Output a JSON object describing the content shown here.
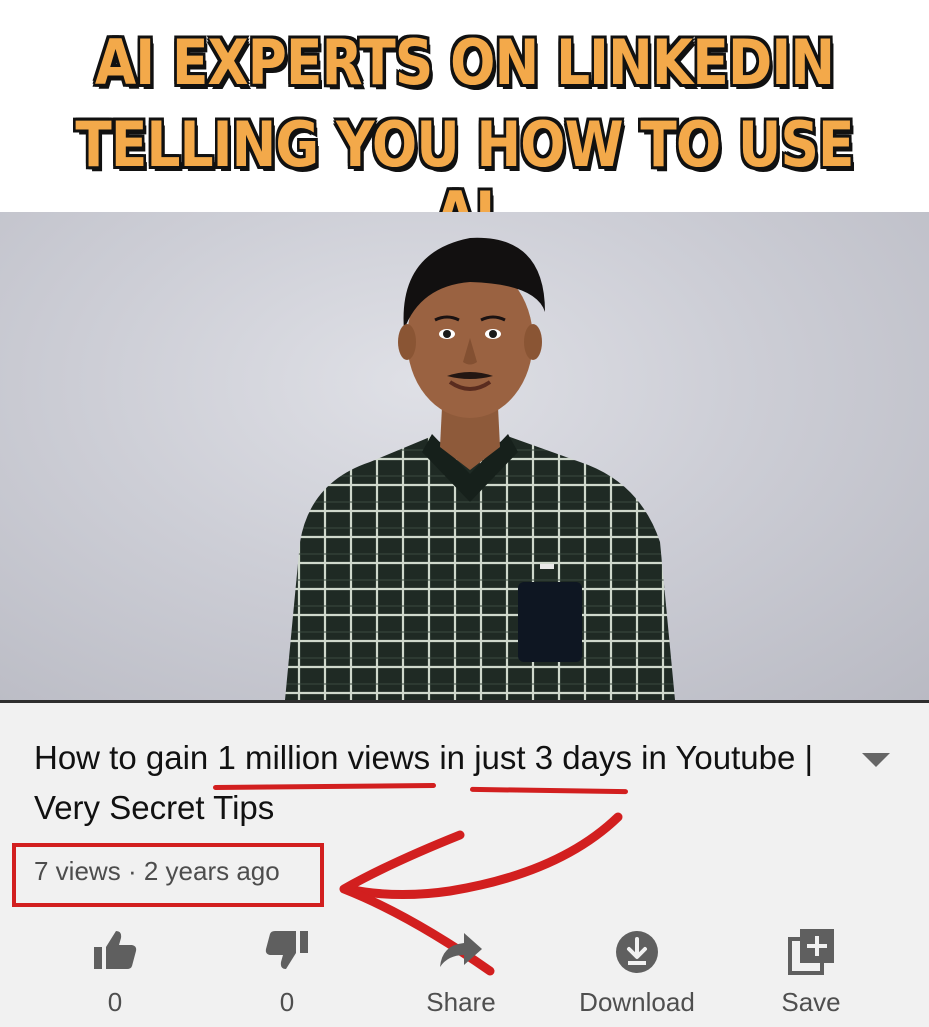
{
  "meme": {
    "line1": "AI EXPERTS ON LINKEDIN",
    "line2": "TELLING YOU HOW TO USE AI"
  },
  "video": {
    "title_parts": [
      "How to gain ",
      "1 million views",
      " in ",
      "just 3 days",
      " in Youtube | Very Secret Tips"
    ],
    "views": "7 views",
    "separator": "·",
    "age": "2 years ago"
  },
  "actions": {
    "like_count": "0",
    "dislike_count": "0",
    "share_label": "Share",
    "download_label": "Download",
    "save_label": "Save"
  },
  "icons": {
    "like": "thumbs-up-icon",
    "dislike": "thumbs-down-icon",
    "share": "share-arrow-icon",
    "download": "download-circle-icon",
    "save": "playlist-add-icon",
    "expand": "chevron-down-icon"
  },
  "colors": {
    "caption_fill": "#f3a94a",
    "caption_outline": "#111111",
    "annotation_red": "#d21f1f",
    "panel_bg": "#f1f1f1"
  }
}
